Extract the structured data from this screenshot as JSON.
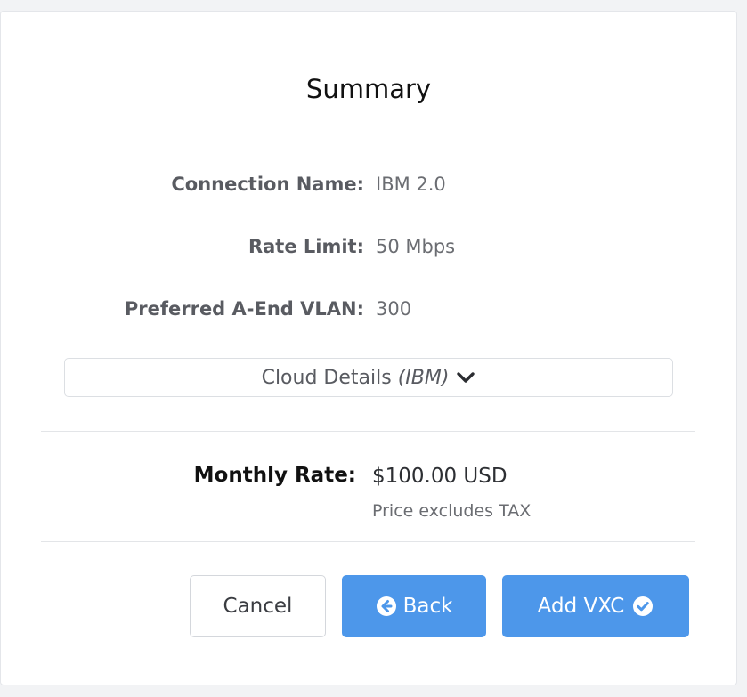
{
  "summary": {
    "title": "Summary",
    "fields": [
      {
        "label": "Connection Name:",
        "value": "IBM 2.0"
      },
      {
        "label": "Rate Limit:",
        "value": "50 Mbps"
      },
      {
        "label": "Preferred A-End VLAN:",
        "value": "300"
      }
    ],
    "cloud_details": {
      "label": "Cloud Details",
      "provider": "(IBM)",
      "icon": "chevron-down-icon",
      "expanded": false
    }
  },
  "pricing": {
    "label": "Monthly Rate:",
    "value": "$100.00 USD",
    "note": "Price excludes TAX"
  },
  "actions": {
    "cancel_label": "Cancel",
    "back_label": "Back",
    "back_icon": "arrow-left-circle-icon",
    "add_label": "Add VXC",
    "add_icon": "check-circle-icon",
    "primary_color": "#4d97ea"
  }
}
